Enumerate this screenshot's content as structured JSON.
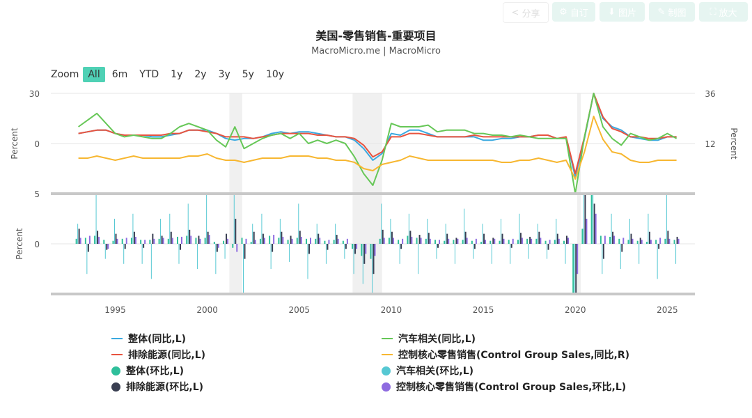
{
  "toolbar": {
    "share": "分享",
    "customize": "自订",
    "image": "图片",
    "draw": "制图",
    "expand": "放大"
  },
  "zoom": {
    "label": "Zoom",
    "buttons": [
      "All",
      "6m",
      "YTD",
      "1y",
      "2y",
      "3y",
      "5y",
      "10y"
    ],
    "active": "All"
  },
  "chart_data": {
    "type": "line",
    "title": "美国-零售销售-重要项目",
    "subtitle": "MacroMicro.me | MacroMicro",
    "x": [
      1993.0,
      1993.5,
      1994.0,
      1994.5,
      1995.0,
      1995.5,
      1996.0,
      1996.5,
      1997.0,
      1997.5,
      1998.0,
      1998.5,
      1999.0,
      1999.5,
      2000.0,
      2000.5,
      2001.0,
      2001.5,
      2002.0,
      2002.5,
      2003.0,
      2003.5,
      2004.0,
      2004.5,
      2005.0,
      2005.5,
      2006.0,
      2006.5,
      2007.0,
      2007.5,
      2008.0,
      2008.5,
      2009.0,
      2009.5,
      2010.0,
      2010.5,
      2011.0,
      2011.5,
      2012.0,
      2012.5,
      2013.0,
      2013.5,
      2014.0,
      2014.5,
      2015.0,
      2015.5,
      2016.0,
      2016.5,
      2017.0,
      2017.5,
      2018.0,
      2018.5,
      2019.0,
      2019.5,
      2020.0,
      2020.5,
      2021.0,
      2021.5,
      2022.0,
      2022.5,
      2023.0,
      2023.5,
      2024.0,
      2024.5,
      2025.0,
      2025.5
    ],
    "xaxis": {
      "ticks": [
        1995,
        2000,
        2005,
        2010,
        2015,
        2020,
        2025
      ],
      "range": [
        1991.5,
        2026.5
      ]
    },
    "panels": [
      {
        "ylabel": "Percent",
        "ylim": [
          -30,
          30
        ],
        "ticks": [
          30,
          0
        ],
        "right_axis": {
          "ylabel": "Percent",
          "ylim": [
            -12,
            36
          ],
          "ticks": [
            36,
            12
          ]
        }
      },
      {
        "ylabel": "Percent",
        "ylim": [
          -5,
          5
        ],
        "ticks": [
          5,
          0
        ]
      }
    ],
    "shaded_periods": [
      [
        2001.2,
        2001.9
      ],
      [
        2007.9,
        2009.5
      ],
      [
        2020.1,
        2020.3
      ]
    ],
    "series": [
      {
        "name": "整体(同比,L)",
        "panel": 0,
        "axis": "left",
        "kind": "line",
        "color": "#3aa9e0",
        "values": [
          6,
          7,
          8,
          8,
          6,
          5,
          5,
          5,
          4,
          4,
          5,
          6,
          8,
          8,
          8,
          6,
          3,
          2,
          3,
          3,
          4,
          6,
          7,
          6,
          7,
          7,
          6,
          5,
          4,
          4,
          2,
          -3,
          -10,
          -6,
          6,
          5,
          8,
          8,
          6,
          4,
          4,
          4,
          4,
          4,
          2,
          2,
          3,
          3,
          4,
          4,
          5,
          5,
          3,
          3,
          -20,
          3,
          40,
          15,
          10,
          8,
          4,
          3,
          2,
          2,
          4,
          4
        ]
      },
      {
        "name": "排除能源(同比,L)",
        "panel": 0,
        "axis": "left",
        "kind": "line",
        "color": "#e8533f",
        "values": [
          6,
          7,
          8,
          8,
          6,
          5,
          5,
          5,
          5,
          5,
          6,
          6,
          8,
          8,
          7,
          6,
          4,
          4,
          4,
          3,
          4,
          5,
          6,
          6,
          6,
          6,
          5,
          5,
          4,
          4,
          3,
          -1,
          -8,
          -5,
          4,
          4,
          6,
          6,
          5,
          4,
          4,
          4,
          4,
          5,
          4,
          4,
          4,
          4,
          4,
          4,
          5,
          5,
          3,
          4,
          -18,
          4,
          38,
          16,
          9,
          7,
          4,
          4,
          3,
          3,
          4,
          4
        ]
      },
      {
        "name": "汽车相关(同比,L)",
        "panel": 0,
        "axis": "left",
        "kind": "line",
        "color": "#66c757",
        "values": [
          10,
          14,
          18,
          12,
          6,
          4,
          5,
          4,
          3,
          3,
          6,
          10,
          12,
          10,
          8,
          2,
          -2,
          10,
          -3,
          0,
          3,
          5,
          6,
          3,
          6,
          0,
          2,
          0,
          2,
          0,
          -8,
          -18,
          -25,
          -10,
          12,
          10,
          10,
          10,
          11,
          7,
          8,
          8,
          8,
          6,
          6,
          5,
          5,
          4,
          5,
          4,
          3,
          3,
          3,
          3,
          -30,
          4,
          50,
          10,
          3,
          -1,
          6,
          4,
          2,
          3,
          6,
          3
        ]
      },
      {
        "name": "控制核心零售销售(Control Group Sales,同比,R)",
        "panel": 0,
        "axis": "right",
        "kind": "line",
        "color": "#f7b731",
        "values": [
          5,
          5,
          6,
          5,
          4,
          5,
          6,
          5,
          5,
          5,
          5,
          5,
          6,
          6,
          7,
          5,
          4,
          4,
          3,
          4,
          5,
          5,
          5,
          6,
          6,
          6,
          5,
          5,
          4,
          4,
          3,
          0,
          -1,
          2,
          3,
          4,
          6,
          5,
          4,
          4,
          4,
          4,
          4,
          4,
          4,
          4,
          3,
          3,
          4,
          4,
          5,
          4,
          3,
          4,
          -5,
          8,
          25,
          14,
          8,
          7,
          4,
          3,
          3,
          4,
          4,
          4
        ]
      },
      {
        "name": "整体(环比,L)",
        "panel": 1,
        "axis": "left",
        "kind": "bar",
        "color": "#2fbf9b",
        "values": [
          0.5,
          0.6,
          0.8,
          0.4,
          0.3,
          0.5,
          0.6,
          0.4,
          0.4,
          0.5,
          0.5,
          0.7,
          0.8,
          0.6,
          0.6,
          0.2,
          0.3,
          -0.4,
          0.6,
          0.2,
          0.5,
          0.8,
          0.6,
          0.4,
          0.6,
          0.5,
          0.5,
          0.3,
          0.4,
          0.3,
          -0.5,
          -1.2,
          -1.5,
          0.5,
          0.6,
          0.4,
          0.8,
          0.6,
          0.5,
          0.4,
          0.3,
          0.4,
          0.4,
          0.3,
          0.2,
          0.3,
          0.3,
          0.4,
          0.4,
          0.5,
          0.5,
          0.3,
          0.4,
          0.3,
          -5,
          1.5,
          5,
          0.8,
          0.7,
          0.5,
          0.4,
          0.3,
          0.2,
          0.4,
          0.5,
          0.4
        ]
      },
      {
        "name": "汽车相关(环比,L)",
        "panel": 1,
        "axis": "left",
        "kind": "bar",
        "color": "#56c8d3",
        "values": [
          2,
          -3,
          5,
          -1.5,
          2.5,
          -2,
          3,
          -2,
          -3.5,
          2.5,
          3,
          -2,
          4,
          -2.5,
          5,
          -3,
          -1.5,
          5,
          -5,
          2,
          3,
          -2.5,
          2.5,
          -1.8,
          4,
          -3.5,
          2,
          -2,
          2,
          -1.5,
          -3,
          -4,
          -5,
          4,
          2.5,
          -2,
          3,
          -3,
          2.5,
          -1.5,
          2,
          -2,
          3.5,
          -1.5,
          2,
          -2,
          2.5,
          -2,
          3,
          -1.5,
          2,
          -1.5,
          2.5,
          -2,
          -5,
          5,
          5,
          -3,
          3,
          -2.5,
          2.5,
          -2,
          3,
          -3.5,
          5,
          -2
        ]
      },
      {
        "name": "排除能源(环比,L)",
        "panel": 1,
        "axis": "left",
        "kind": "bar",
        "color": "#3a3f52",
        "values": [
          1.5,
          -0.8,
          1.3,
          -0.6,
          1,
          -0.5,
          1.2,
          -0.4,
          1,
          0.8,
          1.2,
          -0.6,
          1.4,
          0.8,
          1.2,
          -0.8,
          1,
          2.5,
          -1.5,
          1.2,
          1,
          -0.8,
          1.2,
          0.8,
          1.3,
          -1,
          1,
          -0.6,
          0.9,
          -0.5,
          -1,
          -2,
          -3,
          1.4,
          1.2,
          -0.5,
          1.3,
          0.9,
          1.1,
          -0.4,
          1,
          0.6,
          1.2,
          -0.5,
          1,
          0.6,
          1,
          -0.4,
          1.1,
          0.7,
          1.2,
          -0.6,
          1,
          0.8,
          -5,
          5,
          4,
          -1.5,
          1.2,
          -0.8,
          1,
          0.6,
          1.2,
          -0.5,
          1.3,
          0.7
        ]
      },
      {
        "name": "控制核心零售销售(Control Group Sales,环比,L)",
        "panel": 1,
        "axis": "left",
        "kind": "bar",
        "color": "#8e6be0",
        "values": [
          0.6,
          0.8,
          0.7,
          -0.5,
          0.5,
          0.6,
          0.7,
          0.4,
          0.5,
          0.6,
          0.6,
          0.7,
          0.8,
          0.5,
          0.9,
          -0.4,
          0.5,
          -0.8,
          0.5,
          0.4,
          0.6,
          0.9,
          0.7,
          0.5,
          0.7,
          0.6,
          0.6,
          0.4,
          0.5,
          0.5,
          -0.5,
          -1,
          -1.2,
          0.6,
          0.6,
          0.5,
          0.7,
          0.6,
          0.5,
          0.4,
          0.5,
          0.5,
          0.6,
          0.5,
          0.4,
          0.5,
          0.5,
          0.5,
          0.6,
          0.5,
          0.6,
          0.4,
          0.5,
          0.6,
          -3,
          2.5,
          3,
          0.8,
          0.8,
          0.6,
          0.5,
          0.4,
          0.4,
          0.6,
          0.5,
          0.5
        ]
      }
    ]
  }
}
